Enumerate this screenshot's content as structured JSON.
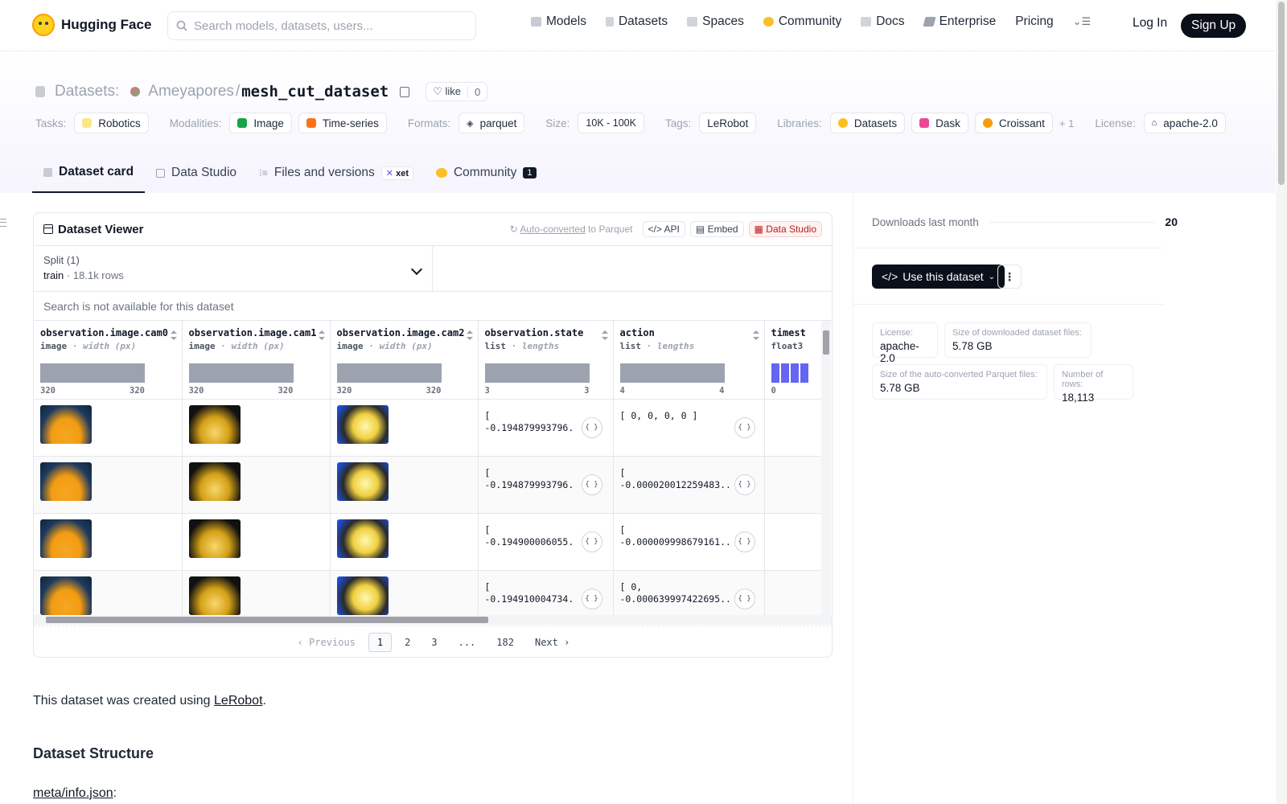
{
  "nav": {
    "brand": "Hugging Face",
    "search_placeholder": "Search models, datasets, users...",
    "links": [
      "Models",
      "Datasets",
      "Spaces",
      "Community",
      "Docs",
      "Enterprise",
      "Pricing"
    ],
    "login": "Log In",
    "signup": "Sign Up"
  },
  "header": {
    "section": "Datasets:",
    "owner": "Ameyapores",
    "separator": "/",
    "name": "mesh_cut_dataset",
    "like_label": "like",
    "like_count": "0"
  },
  "tags": {
    "tasks_label": "Tasks:",
    "tasks": [
      "Robotics"
    ],
    "modalities_label": "Modalities:",
    "modalities": [
      "Image",
      "Time-series"
    ],
    "formats_label": "Formats:",
    "formats": [
      "parquet"
    ],
    "size_label": "Size:",
    "size": [
      "10K - 100K"
    ],
    "tags_label": "Tags:",
    "tags": [
      "LeRobot"
    ],
    "libraries_label": "Libraries:",
    "libraries": [
      "Datasets",
      "Dask",
      "Croissant"
    ],
    "libraries_more": "+ 1",
    "license_label": "License:",
    "license": [
      "apache-2.0"
    ]
  },
  "tabs": [
    {
      "label": "Dataset card",
      "active": true
    },
    {
      "label": "Data Studio"
    },
    {
      "label": "Files and versions",
      "badge": "xet"
    },
    {
      "label": "Community",
      "badge": "1"
    }
  ],
  "viewer": {
    "title": "Dataset Viewer",
    "auto_converted": "Auto-converted",
    "to_parquet": " to Parquet",
    "api": "API",
    "embed": "Embed",
    "data_studio": "Data Studio",
    "split_label": "Split (1)",
    "split_name": "train",
    "split_rows": "18.1k rows",
    "search_na": "Search is not available for this dataset",
    "columns": [
      {
        "name": "observation.image.cam0",
        "type": "image",
        "sub": "width (px)",
        "min": "320",
        "max": "320"
      },
      {
        "name": "observation.image.cam1",
        "type": "image",
        "sub": "width (px)",
        "min": "320",
        "max": "320"
      },
      {
        "name": "observation.image.cam2",
        "type": "image",
        "sub": "width (px)",
        "min": "320",
        "max": "320"
      },
      {
        "name": "observation.state",
        "type": "list",
        "sub": "lengths",
        "min": "3",
        "max": "3"
      },
      {
        "name": "action",
        "type": "list",
        "sub": "lengths",
        "min": "4",
        "max": "4"
      },
      {
        "name": "timest",
        "type": "float3",
        "sub": "",
        "min": "0",
        "max": ""
      }
    ],
    "rows": [
      {
        "state_l1": "[",
        "state_l2": "-0.194879993796...",
        "action_l1": "[ 0, 0, 0, 0 ]",
        "action_l2": ""
      },
      {
        "state_l1": "[",
        "state_l2": "-0.194879993796...",
        "action_l1": "[",
        "action_l2": "-0.000020012259483..."
      },
      {
        "state_l1": "[",
        "state_l2": "-0.194900006055...",
        "action_l1": "[",
        "action_l2": "-0.000009998679161..."
      },
      {
        "state_l1": "[",
        "state_l2": "-0.194910004734...",
        "action_l1": "[ 0,",
        "action_l2": "-0.000639997422695..."
      }
    ],
    "json_label": "{ }",
    "pager": {
      "prev": "Previous",
      "pages": [
        "1",
        "2",
        "3",
        "...",
        "182"
      ],
      "next": "Next"
    }
  },
  "sidebar": {
    "downloads_label": "Downloads last month",
    "downloads_value": "20",
    "use_button": "Use this dataset",
    "cards": [
      {
        "label": "License:",
        "value": "apache-2.0"
      },
      {
        "label": "Size of downloaded dataset files:",
        "value": "5.78 GB"
      },
      {
        "label": "Size of the auto-converted Parquet files:",
        "value": "5.78 GB"
      },
      {
        "label": "Number of rows:",
        "value": "18,113"
      }
    ]
  },
  "body": {
    "intro_prefix": "This dataset was created using ",
    "intro_link": "LeRobot",
    "intro_suffix": ".",
    "structure_heading": "Dataset Structure",
    "meta_link": "meta/info.json",
    "meta_suffix": ":"
  },
  "colors": {
    "accent": "#ff9d00",
    "brand_dark": "#0b0f19",
    "hist_gray": "#9ca3af",
    "hist_blue": "#6366f1"
  }
}
